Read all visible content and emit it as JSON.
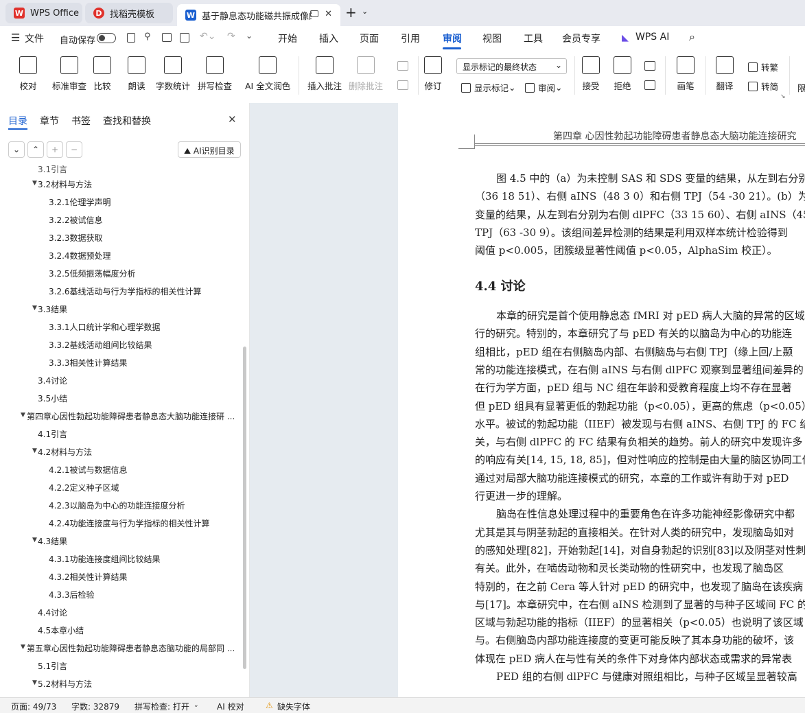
{
  "tabs": [
    {
      "label": "WPS Office"
    },
    {
      "label": "找稻壳模板"
    },
    {
      "label": "基于静息态功能磁共振成像的"
    }
  ],
  "menu": {
    "file": "文件",
    "autosave": "自动保存",
    "items": [
      "开始",
      "插入",
      "页面",
      "引用",
      "审阅",
      "视图",
      "工具",
      "会员专享",
      "WPS AI"
    ],
    "active": "审阅"
  },
  "ribbon": {
    "proofread": "校对",
    "standard_review": "标准审查",
    "compare": "比较",
    "read_aloud": "朗读",
    "word_count": "字数统计",
    "spell_check": "拼写检查",
    "ai_polish": "AI 全文润色",
    "insert_comment": "插入批注",
    "delete_comment": "删除批注",
    "revise": "修订",
    "show_markup_select": "显示标记的最终状态",
    "show_markup": "显示标记",
    "review": "审阅",
    "accept": "接受",
    "reject": "拒绝",
    "brush": "画笔",
    "translate": "翻译",
    "to_traditional": "转繁",
    "to_simplified": "转简",
    "limit": "限"
  },
  "sidebar": {
    "tabs": [
      "目录",
      "章节",
      "书签",
      "查找和替换"
    ],
    "ai_toc": "AI识别目录",
    "toc": [
      {
        "text": "3.2材料与方法",
        "level": 2,
        "caret": true
      },
      {
        "text": "3.2.1伦理学声明",
        "level": 3
      },
      {
        "text": "3.2.2被试信息",
        "level": 3
      },
      {
        "text": "3.2.3数据获取",
        "level": 3
      },
      {
        "text": "3.2.4数据预处理",
        "level": 3
      },
      {
        "text": "3.2.5低频振荡幅度分析",
        "level": 3
      },
      {
        "text": "3.2.6基线活动与行为学指标的相关性计算",
        "level": 3
      },
      {
        "text": "3.3结果",
        "level": 2,
        "caret": true
      },
      {
        "text": "3.3.1人口统计学和心理学数据",
        "level": 3
      },
      {
        "text": "3.3.2基线活动组间比较结果",
        "level": 3
      },
      {
        "text": "3.3.3相关性计算结果",
        "level": 3
      },
      {
        "text": "3.4讨论",
        "level": 2
      },
      {
        "text": "3.5小结",
        "level": 2
      },
      {
        "text": "第四章心因性勃起功能障碍患者静息态大脑功能连接研 ...",
        "level": 1,
        "caret": true
      },
      {
        "text": "4.1引言",
        "level": 2
      },
      {
        "text": "4.2材料与方法",
        "level": 2,
        "caret": true
      },
      {
        "text": "4.2.1被试与数据信息",
        "level": 3
      },
      {
        "text": "4.2.2定义种子区域",
        "level": 3
      },
      {
        "text": "4.2.3以脑岛为中心的功能连接度分析",
        "level": 3
      },
      {
        "text": "4.2.4功能连接度与行为学指标的相关性计算",
        "level": 3
      },
      {
        "text": "4.3结果",
        "level": 2,
        "caret": true
      },
      {
        "text": "4.3.1功能连接度组间比较结果",
        "level": 3
      },
      {
        "text": "4.3.2相关性计算结果",
        "level": 3
      },
      {
        "text": "4.3.3后检验",
        "level": 3
      },
      {
        "text": "4.4讨论",
        "level": 2
      },
      {
        "text": "4.5本章小结",
        "level": 2
      },
      {
        "text": "第五章心因性勃起功能障碍患者静息态脑功能的局部同 ...",
        "level": 1,
        "caret": true
      },
      {
        "text": "5.1引言",
        "level": 2
      },
      {
        "text": "5.2材料与方法",
        "level": 2,
        "caret": true
      }
    ]
  },
  "doc": {
    "header": "第四章  心因性勃起功能障碍患者静息态大脑功能连接研究",
    "heading": "4.4 讨论",
    "lines_a": [
      "图 4.5 中的（a）为未控制 SAS 和 SDS 变量的结果，从左到右分别",
      "（36 18 51）、右侧 aINS（48 3 0）和右侧 TPJ（54 -30 21）。(b）为控",
      "变量的结果，从左到右分别为右侧 dlPFC（33 15 60）、右侧 aINS（45",
      "TPJ（63 -30 9）。该组间差异检测的结果是利用双样本统计检验得到",
      "阈值 p<0.005，团簇级显著性阈值 p<0.05，AlphaSim 校正）。"
    ],
    "lines_b": [
      "本章的研究是首个使用静息态 fMRI 对 pED 病人大脑的异常的区域",
      "行的研究。特别的，本章研究了与 pED 有关的以脑岛为中心的功能连",
      "组相比，pED 组在右侧脑岛内部、右侧脑岛与右侧 TPJ（缘上回/上颞",
      "常的功能连接模式，在右侧 aINS 与右侧 dlPFC 观察到显著组间差异的",
      "在行为学方面，pED 组与 NC 组在年龄和受教育程度上均不存在显著",
      "但 pED 组具有显著更低的勃起功能（p<0.05），更高的焦虑（p<0.05）和",
      "水平。被试的勃起功能（IIEF）被发现与右侧 aINS、右侧 TPJ 的 FC 结",
      "关，与右侧 dlPFC 的 FC 结果有负相关的趋势。前人的研究中发现许多",
      "的响应有关[14, 15, 18, 85]，但对性响应的控制是由大量的脑区协同工作完成",
      "通过对局部大脑功能连接模式的研究，本章的工作或许有助于对 pED",
      "行更进一步的理解。",
      "脑岛在性信息处理过程中的重要角色在许多功能神经影像研究中都",
      "尤其是其与阴茎勃起的直接相关。在针对人类的研究中，发现脑岛如对",
      "的感知处理[82]，开始勃起[14]，对自身勃起的识别[83]以及阴茎对性刺激的",
      "有关。此外，在啮齿动物和灵长类动物的性研究中，也发现了脑岛区",
      "特别的，在之前 Cera 等人针对 pED 的研究中，也发现了脑岛在该疾病",
      "与[17]。本章研究中，在右侧 aINS 检测到了显著的与种子区域间 FC 的",
      "区域与勃起功能的指标（IIEF）的显著相关（p<0.05）也说明了该区域",
      "与。右侧脑岛内部功能连接度的变更可能反映了其本身功能的破坏，该",
      "体现在 pED 病人在与性有关的条件下对身体内部状态或需求的异常表",
      "PED 组的右侧 dlPFC 与健康对照组相比，与种子区域呈显著较高"
    ]
  },
  "status": {
    "page": "页面: 49/73",
    "words": "字数: 32879",
    "spell": "拼写检查: 打开",
    "ai": "AI 校对",
    "font": "缺失字体"
  },
  "colors": {
    "accent": "#1a5fd0",
    "wps_red": "#e0322c"
  }
}
